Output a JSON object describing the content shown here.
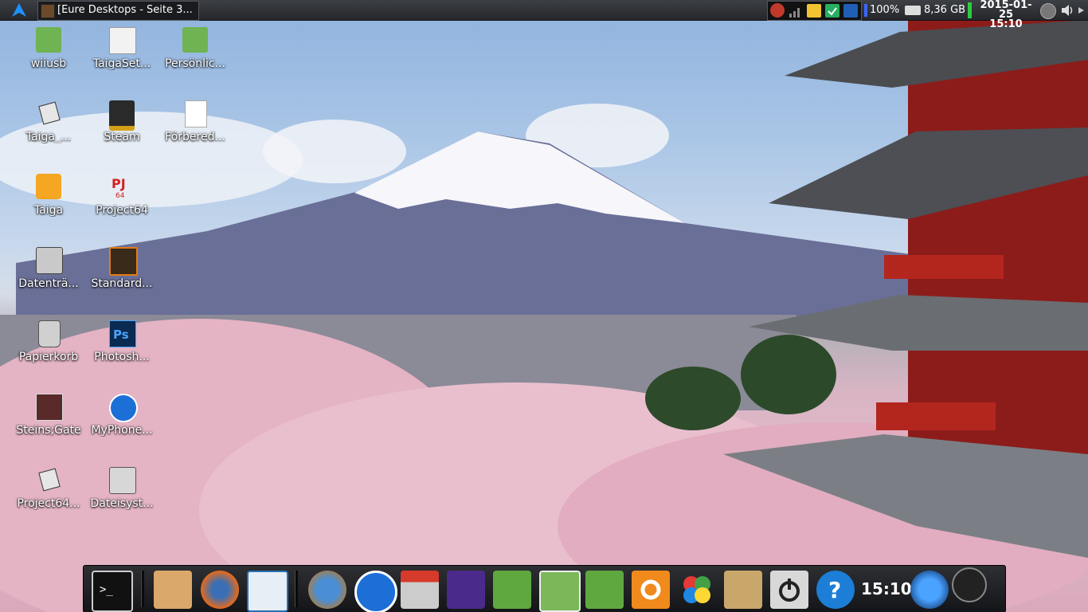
{
  "panel": {
    "window_title": "[Eure Desktops - Seite 3...",
    "battery": "100%",
    "disk": "8,36 GB",
    "date": "2015-01-25",
    "time": "15:10"
  },
  "desktop_icons": [
    {
      "label": "wiiusb"
    },
    {
      "label": "TaigaSet..."
    },
    {
      "label": "Persönlic..."
    },
    {
      "label": "Taiga_..."
    },
    {
      "label": "Steam"
    },
    {
      "label": "Förbered..."
    },
    {
      "label": "Taiga"
    },
    {
      "label": "Project64"
    },
    {
      "label": "Datenträ..."
    },
    {
      "label": "Standard..."
    },
    {
      "label": "Papierkorb"
    },
    {
      "label": "Photosh..."
    },
    {
      "label": "Steins;Gate"
    },
    {
      "label": "MyPhone..."
    },
    {
      "label": "Project64..."
    },
    {
      "label": "Dateisyst..."
    }
  ],
  "dock": {
    "clock": "15:10"
  },
  "colors": {
    "panel_bg": "#2b2d31",
    "dock_bg": "#1c1d20",
    "folder_green": "#6fb352",
    "accent_orange": "#f08a1c"
  }
}
